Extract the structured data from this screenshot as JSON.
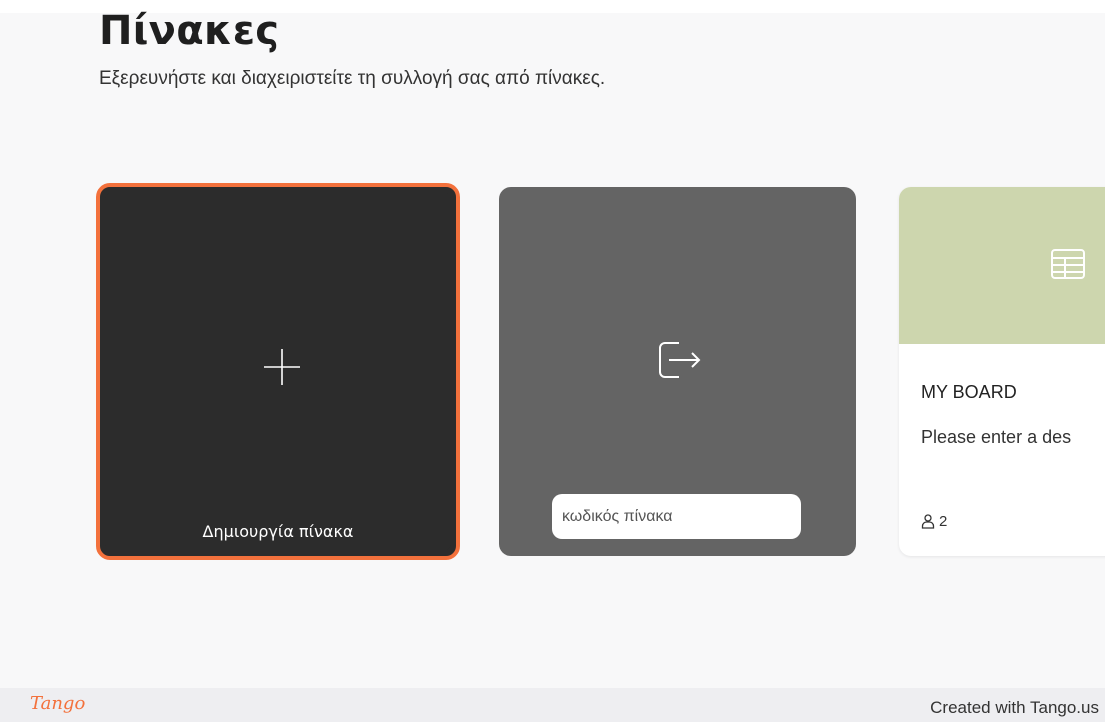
{
  "page": {
    "title": "Πίνακες",
    "subtitle": "Εξερευνήστε και διαχειριστείτε τη συλλογή σας από πίνακες."
  },
  "create_card": {
    "label": "Δημιουργία πίνακα",
    "icon": "plus-icon",
    "border_color": "#f3713c",
    "background": "#2c2c2c"
  },
  "join_card": {
    "icon": "enter-board-icon",
    "input_placeholder": "κωδικός πίνακα",
    "input_value": "",
    "background": "#646464"
  },
  "board_card": {
    "name": "MY BOARD",
    "description": "Please enter a des",
    "members": "2",
    "icon": "table-icon",
    "banner_color": "#cdd6ae"
  },
  "footer": {
    "logo": "Tango",
    "text": "Created with Tango.us"
  }
}
